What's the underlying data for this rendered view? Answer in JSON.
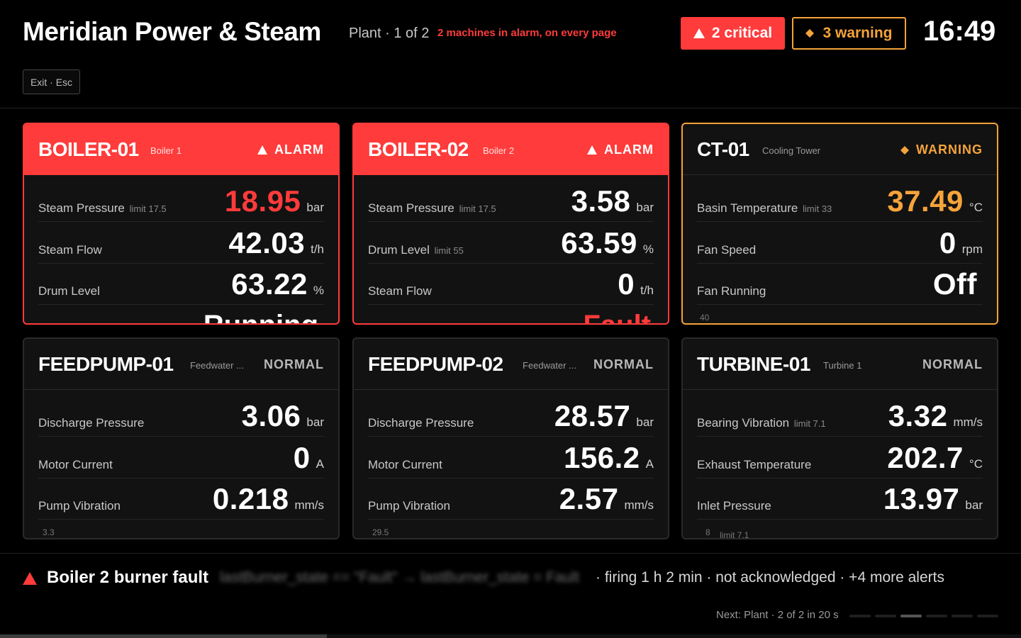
{
  "header": {
    "title": "Meridian Power & Steam",
    "plant": "Plant · 1 of 2",
    "alarm_note": "2 machines in alarm, on every page",
    "critical_label": "2 critical",
    "warning_label": "3 warning",
    "clock": "16:49",
    "exit_label": "Exit · Esc"
  },
  "colors": {
    "alarm": "#ff3b3b",
    "warning": "#f5a33b",
    "background": "#000000",
    "card": "#121212"
  },
  "cards": [
    {
      "id": "BOILER-01",
      "sub": "Boiler 1",
      "status": "ALARM",
      "state": "alarm",
      "metrics": [
        {
          "label": "Steam Pressure",
          "limit": "limit 17.5",
          "value": "18.95",
          "unit": "bar"
        },
        {
          "label": "Steam Flow",
          "limit": "",
          "value": "42.03",
          "unit": "t/h"
        },
        {
          "label": "Drum Level",
          "limit": "",
          "value": "63.22",
          "unit": "%"
        }
      ],
      "overflow_text": "Running"
    },
    {
      "id": "BOILER-02",
      "sub": "Boiler 2",
      "status": "ALARM",
      "state": "alarm",
      "metrics": [
        {
          "label": "Steam Pressure",
          "limit": "limit 17.5",
          "value": "3.58",
          "unit": "bar"
        },
        {
          "label": "Drum Level",
          "limit": "limit 55",
          "value": "63.59",
          "unit": "%"
        },
        {
          "label": "Steam Flow",
          "limit": "",
          "value": "0",
          "unit": "t/h"
        }
      ],
      "overflow_text": "Fault"
    },
    {
      "id": "CT-01",
      "sub": "Cooling Tower",
      "status": "WARNING",
      "state": "warning",
      "metrics": [
        {
          "label": "Basin Temperature",
          "limit": "limit 33",
          "value": "37.49",
          "unit": "°C"
        },
        {
          "label": "Fan Speed",
          "limit": "",
          "value": "0",
          "unit": "rpm"
        },
        {
          "label": "Fan Running",
          "limit": "",
          "value": "Off",
          "unit": ""
        }
      ],
      "spark_label": "40"
    },
    {
      "id": "FEEDPUMP-01",
      "sub": "Feedwater ...",
      "status": "NORMAL",
      "state": "normal",
      "metrics": [
        {
          "label": "Discharge Pressure",
          "limit": "",
          "value": "3.06",
          "unit": "bar"
        },
        {
          "label": "Motor Current",
          "limit": "",
          "value": "0",
          "unit": "A"
        },
        {
          "label": "Pump Vibration",
          "limit": "",
          "value": "0.218",
          "unit": "mm/s"
        }
      ],
      "spark_label": "3.3"
    },
    {
      "id": "FEEDPUMP-02",
      "sub": "Feedwater ...",
      "status": "NORMAL",
      "state": "normal",
      "metrics": [
        {
          "label": "Discharge Pressure",
          "limit": "",
          "value": "28.57",
          "unit": "bar"
        },
        {
          "label": "Motor Current",
          "limit": "",
          "value": "156.2",
          "unit": "A"
        },
        {
          "label": "Pump Vibration",
          "limit": "",
          "value": "2.57",
          "unit": "mm/s"
        }
      ],
      "spark_label": "29.5"
    },
    {
      "id": "TURBINE-01",
      "sub": "Turbine 1",
      "status": "NORMAL",
      "state": "normal",
      "metrics": [
        {
          "label": "Bearing Vibration",
          "limit": "limit 7.1",
          "value": "3.32",
          "unit": "mm/s"
        },
        {
          "label": "Exhaust Temperature",
          "limit": "",
          "value": "202.7",
          "unit": "°C"
        },
        {
          "label": "Inlet Pressure",
          "limit": "",
          "value": "13.97",
          "unit": "bar"
        }
      ],
      "spark_label": "8",
      "spark_limit": "limit 7.1"
    }
  ],
  "footer": {
    "alert_title": "Boiler 2 burner fault",
    "alert_expr": "lastBurner_state == \"Fault\" → lastBurner_state = Fault",
    "alert_meta": "· firing 1 h 2 min · not acknowledged · +4 more alerts",
    "next_label": "Next: Plant · 2 of 2 in 20 s",
    "page_progress": 0.32
  }
}
